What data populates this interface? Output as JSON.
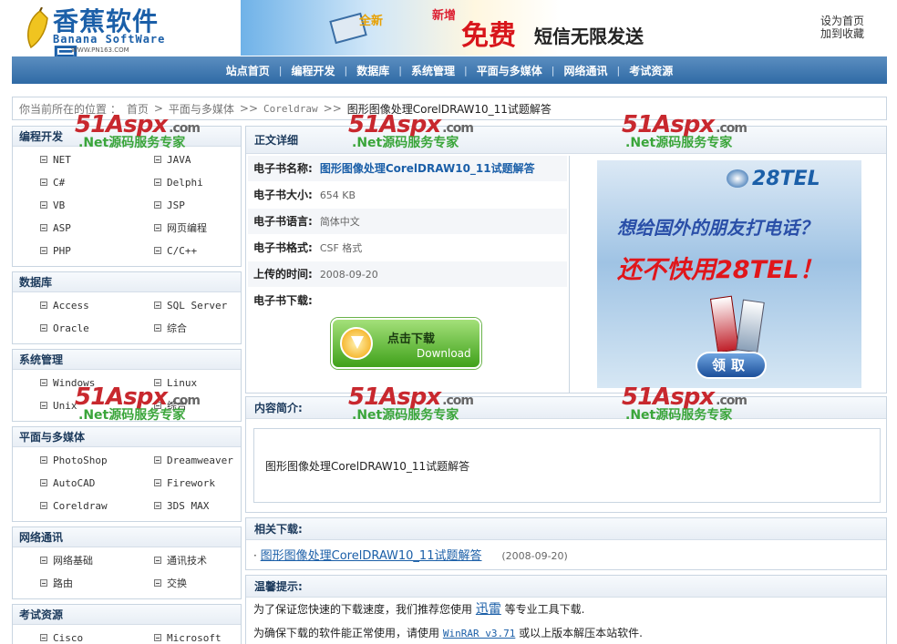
{
  "header": {
    "logo_cn": "香蕉软件园",
    "logo_en": "Banana SoftWare",
    "logo_url": "WWW.PN163.COM",
    "banner": {
      "tag1": "全新",
      "tag2": "新增",
      "free": "免费",
      "sms": "短信无限发送"
    },
    "links": [
      "设为首页",
      "加到收藏"
    ]
  },
  "nav": [
    "站点首页",
    "编程开发",
    "数据库",
    "系统管理",
    "平面与多媒体",
    "网络通讯",
    "考试资源"
  ],
  "breadcrumb": {
    "prefix": "你当前所在的位置 ：",
    "home": "首页",
    "sep1": ">",
    "cat": "平面与多媒体",
    "sep2": ">>",
    "sub": "Coreldraw",
    "sep3": ">>",
    "current": "图形图像处理CorelDRAW10_11试题解答"
  },
  "sidebar": [
    {
      "title": "编程开发",
      "items": [
        "NET",
        "JAVA",
        "C#",
        "Delphi",
        "VB",
        "JSP",
        "ASP",
        "网页编程",
        "PHP",
        "C/C++"
      ]
    },
    {
      "title": "数据库",
      "items": [
        "Access",
        "SQL Server",
        "Oracle",
        "综合"
      ]
    },
    {
      "title": "系统管理",
      "items": [
        "Windows",
        "Linux",
        "Unix",
        "综合"
      ]
    },
    {
      "title": "平面与多媒体",
      "items": [
        "PhotoShop",
        "Dreamweaver",
        "AutoCAD",
        "Firework",
        "Coreldraw",
        "3DS MAX"
      ]
    },
    {
      "title": "网络通讯",
      "items": [
        "网络基础",
        "通讯技术",
        "路由",
        "交换"
      ]
    },
    {
      "title": "考试资源",
      "items": [
        "Cisco",
        "Microsoft"
      ]
    }
  ],
  "detail": {
    "title": "正文详细",
    "rows": [
      {
        "k": "电子书名称:",
        "v": "图形图像处理CorelDRAW10_11试题解答"
      },
      {
        "k": "电子书大小:",
        "v": "654 KB"
      },
      {
        "k": "电子书语言:",
        "v": "简体中文"
      },
      {
        "k": "电子书格式:",
        "v": "CSF 格式"
      },
      {
        "k": "上传的时间:",
        "v": "2008-09-20"
      },
      {
        "k": "电子书下载:",
        "v": ""
      }
    ],
    "download_cn": "点击下载",
    "download_en": "Download"
  },
  "ad": {
    "brand": "28TEL",
    "line1": "想给国外的朋友打电话？",
    "line2": "还不快用28TEL！",
    "button": "领取"
  },
  "intro": {
    "title": "内容简介:",
    "text": "图形图像处理CorelDRAW10_11试题解答"
  },
  "related": {
    "title": "相关下载:",
    "link": "图形图像处理CorelDRAW10_11试题解答",
    "date": "(2008-09-20)"
  },
  "tips": {
    "title": "温馨提示:",
    "line1_a": "为了保证您快速的下载速度，我们推荐您使用",
    "line1_link": "迅雷",
    "line1_b": "等专业工具下载.",
    "line2_a": "为确保下载的软件能正常使用，请使用",
    "line2_link": "WinRAR v3.71",
    "line2_b": "或以上版本解压本站软件."
  },
  "watermark": {
    "brand": "51Aspx",
    "dom": ".com",
    "slogan": ".Net源码服务专家"
  },
  "colors": {
    "nav_bg": "#2f6aa5",
    "link": "#1b5fa8",
    "watermark_red": "#c8282e",
    "watermark_green": "#3aa53a"
  }
}
